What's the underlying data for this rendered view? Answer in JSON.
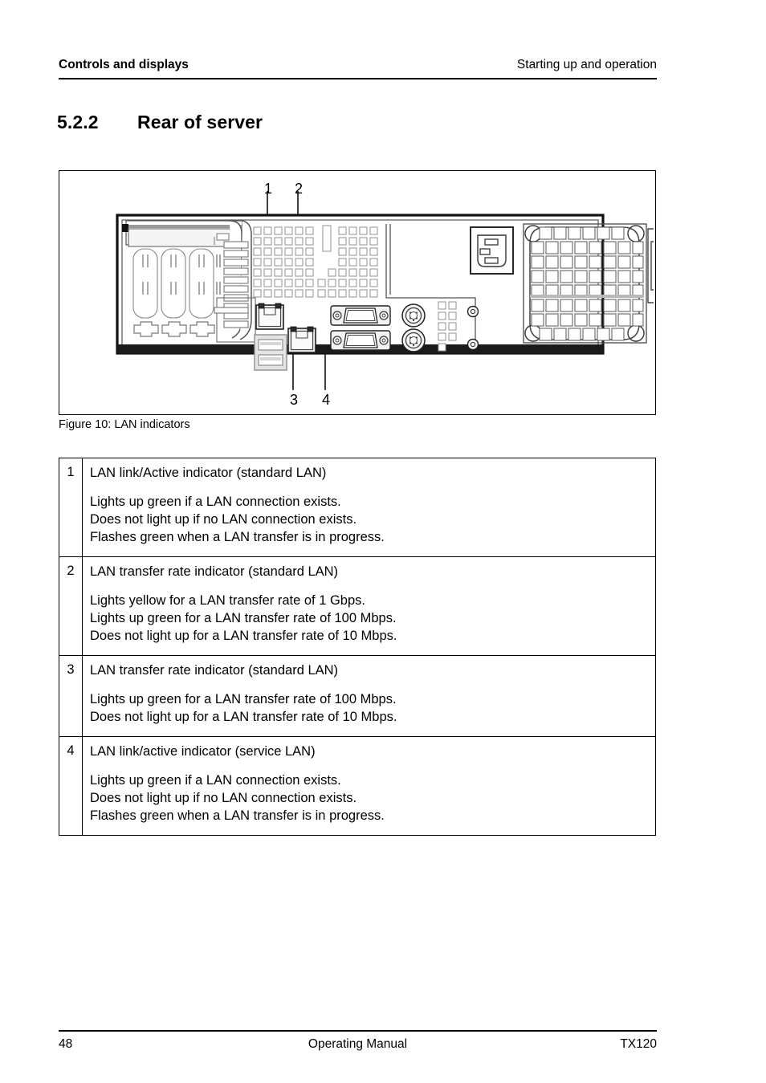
{
  "header": {
    "left": "Controls and displays",
    "right": "Starting up and operation"
  },
  "section": {
    "number": "5.2.2",
    "title": "Rear of server"
  },
  "figure": {
    "caption": "Figure 10: LAN indicators",
    "callouts": [
      {
        "label": "1"
      },
      {
        "label": "2"
      },
      {
        "label": "3"
      },
      {
        "label": "4"
      }
    ],
    "components": {
      "power_connector": "iec-c14-power-inlet",
      "fan_grid": "psu-fan-grille",
      "lan_port_standard": "rj45-standard-lan-port",
      "lan_port_service": "rj45-service-lan-port",
      "usb_ports": "usb-port-stack",
      "serial_port": "db9-serial-port",
      "vga_port": "vga-port",
      "ps2_ports": "ps2-keyboard-mouse-ports",
      "pci_slots": "pci-expansion-slots"
    }
  },
  "table": {
    "rows": [
      {
        "index": "1",
        "title": "LAN link/Active indicator (standard LAN)",
        "details": [
          "Lights up green if a LAN connection exists.",
          "Does not light up if no LAN connection exists.",
          "Flashes green when a LAN transfer is in progress."
        ]
      },
      {
        "index": "2",
        "title": "LAN transfer rate indicator (standard LAN)",
        "details": [
          "Lights yellow for a LAN transfer rate of 1 Gbps.",
          "Lights up green for a LAN transfer rate of 100 Mbps.",
          "Does not light up for a LAN transfer rate of 10 Mbps."
        ]
      },
      {
        "index": "3",
        "title": "LAN transfer rate indicator (standard LAN)",
        "details": [
          "Lights up green for a LAN transfer rate of 100 Mbps.",
          "Does not light up for a LAN transfer rate of 10 Mbps."
        ]
      },
      {
        "index": "4",
        "title": "LAN link/active indicator (service LAN)",
        "details": [
          "Lights up green if a LAN connection exists.",
          "Does not light up if no LAN connection exists.",
          "Flashes green when a LAN transfer is in progress."
        ]
      }
    ]
  },
  "footer": {
    "page_number": "48",
    "document_title": "Operating Manual",
    "product": "TX120"
  }
}
